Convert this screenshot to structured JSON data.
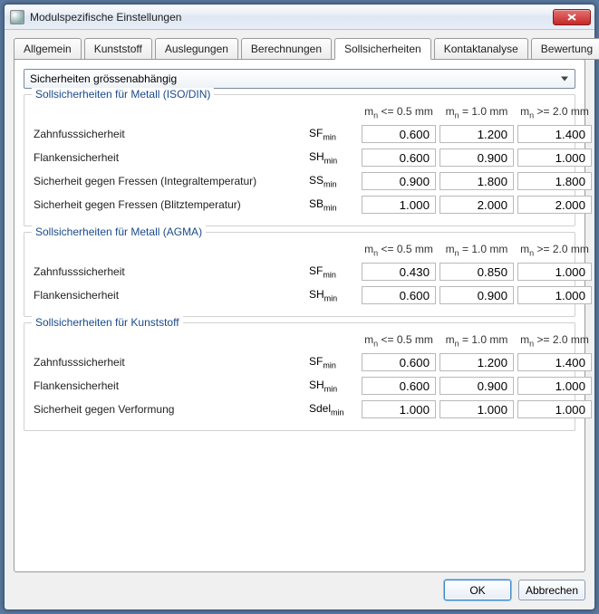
{
  "window": {
    "title": "Modulspezifische Einstellungen"
  },
  "tabs": {
    "items": [
      {
        "label": "Allgemein"
      },
      {
        "label": "Kunststoff"
      },
      {
        "label": "Auslegungen"
      },
      {
        "label": "Berechnungen"
      },
      {
        "label": "Sollsicherheiten"
      },
      {
        "label": "Kontaktanalyse"
      },
      {
        "label": "Bewertung"
      }
    ],
    "active_index": 4
  },
  "dropdown": {
    "selected": "Sicherheiten grössenabhängig"
  },
  "columns": {
    "c1_html": "m<sub>n</sub> <= 0.5 mm",
    "c2_html": "m<sub>n</sub> = 1.0 mm",
    "c3_html": "m<sub>n</sub> >= 2.0 mm"
  },
  "groups": [
    {
      "title": "Sollsicherheiten für Metall (ISO/DIN)",
      "rows": [
        {
          "label": "Zahnfusssicherheit",
          "symbol_html": "SF<sub>min</sub>",
          "v1": "0.600",
          "v2": "1.200",
          "v3": "1.400"
        },
        {
          "label": "Flankensicherheit",
          "symbol_html": "SH<sub>min</sub>",
          "v1": "0.600",
          "v2": "0.900",
          "v3": "1.000"
        },
        {
          "label": "Sicherheit gegen Fressen (Integraltemperatur)",
          "symbol_html": "SS<sub>min</sub>",
          "v1": "0.900",
          "v2": "1.800",
          "v3": "1.800"
        },
        {
          "label": "Sicherheit gegen Fressen (Blitztemperatur)",
          "symbol_html": "SB<sub>min</sub>",
          "v1": "1.000",
          "v2": "2.000",
          "v3": "2.000"
        }
      ]
    },
    {
      "title": "Sollsicherheiten für Metall (AGMA)",
      "rows": [
        {
          "label": "Zahnfusssicherheit",
          "symbol_html": "SF<sub>min</sub>",
          "v1": "0.430",
          "v2": "0.850",
          "v3": "1.000"
        },
        {
          "label": "Flankensicherheit",
          "symbol_html": "SH<sub>min</sub>",
          "v1": "0.600",
          "v2": "0.900",
          "v3": "1.000"
        }
      ]
    },
    {
      "title": "Sollsicherheiten für Kunststoff",
      "rows": [
        {
          "label": "Zahnfusssicherheit",
          "symbol_html": "SF<sub>min</sub>",
          "v1": "0.600",
          "v2": "1.200",
          "v3": "1.400"
        },
        {
          "label": "Flankensicherheit",
          "symbol_html": "SH<sub>min</sub>",
          "v1": "0.600",
          "v2": "0.900",
          "v3": "1.000"
        },
        {
          "label": "Sicherheit gegen Verformung",
          "symbol_html": "Sdel<sub>min</sub>",
          "v1": "1.000",
          "v2": "1.000",
          "v3": "1.000"
        }
      ]
    }
  ],
  "buttons": {
    "ok": "OK",
    "cancel": "Abbrechen"
  }
}
